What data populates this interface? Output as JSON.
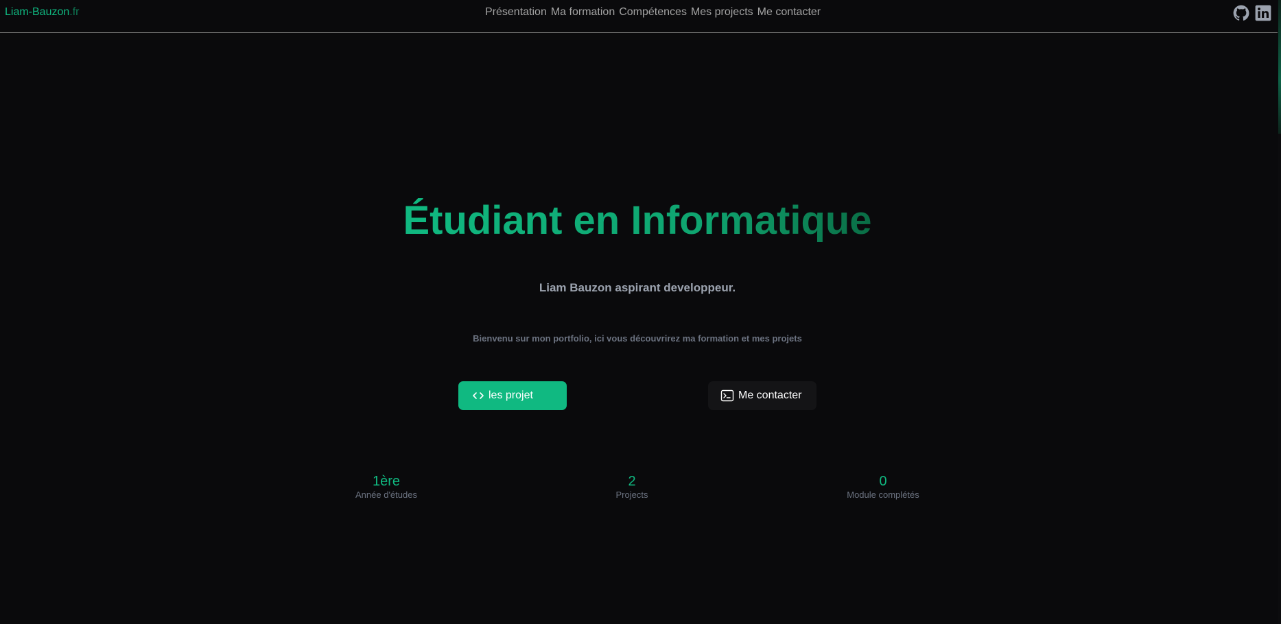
{
  "header": {
    "logo_main": "Liam-Bauzon",
    "logo_tld": ".fr",
    "nav": [
      "Présentation",
      "Ma formation",
      "Compétences",
      "Mes projects",
      "Me contacter"
    ],
    "social_icons": [
      "github-icon",
      "linkedin-icon"
    ]
  },
  "hero": {
    "title": "Étudiant en Informatique",
    "subtitle": "Liam Bauzon aspirant developpeur.",
    "tagline": "Bienvenu sur mon portfolio, ici vous découvrirez ma formation et mes projets"
  },
  "buttons": {
    "primary_label": "les projet",
    "primary_icon": "code-brackets-icon",
    "secondary_label": "Me contacter",
    "secondary_icon": "terminal-icon"
  },
  "stats": [
    {
      "value": "1ère",
      "label": "Année d'études"
    },
    {
      "value": "2",
      "label": "Projects"
    },
    {
      "value": "0",
      "label": "Module complétés"
    }
  ],
  "colors": {
    "background": "#0a0a0c",
    "accent": "#10b981",
    "nav_text": "#a3a3a3",
    "muted_text": "#6b7280",
    "secondary_button": "#141416"
  }
}
